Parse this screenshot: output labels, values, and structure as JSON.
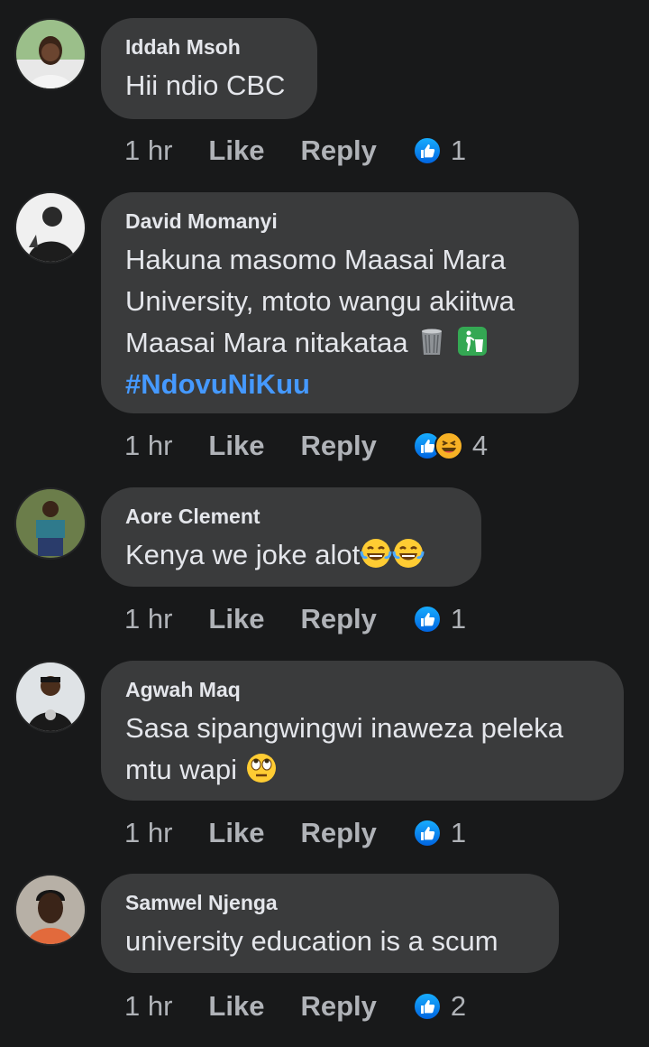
{
  "comments": [
    {
      "author": "Iddah Msoh",
      "lines": [
        "Hii ndio CBC"
      ],
      "time": "1 hr",
      "like": "Like",
      "reply": "Reply",
      "reactions": "1"
    },
    {
      "author": "David Momanyi",
      "lines": [
        "Hakuna masomo Maasai Mara",
        "University, mtoto wangu akiitwa",
        "Maasai Mara nitakataa"
      ],
      "hashtag": "#NdovuNiKuu",
      "time": "1 hr",
      "like": "Like",
      "reply": "Reply",
      "reactions": "4"
    },
    {
      "author": "Aore Clement",
      "lines": [
        "Kenya we joke alot"
      ],
      "time": "1 hr",
      "like": "Like",
      "reply": "Reply",
      "reactions": "1"
    },
    {
      "author": "Agwah Maq",
      "lines": [
        "Sasa sipangwingwi inaweza peleka",
        "mtu wapi"
      ],
      "time": "1 hr",
      "like": "Like",
      "reply": "Reply",
      "reactions": "1"
    },
    {
      "author": "Samwel Njenga",
      "lines": [
        "university education is a scum"
      ],
      "time": "1 hr",
      "like": "Like",
      "reply": "Reply",
      "reactions": "2"
    }
  ],
  "icons": {
    "like_reaction": "thumbs-up-icon",
    "haha_reaction": "laughing-face-icon",
    "trash_emoji": "wastebasket-icon",
    "litter_emoji": "put-litter-in-bin-icon",
    "tears_emoji": "tears-of-joy-icon",
    "eyeroll_emoji": "eye-roll-face-icon"
  },
  "colors": {
    "background": "#18191a",
    "bubble": "#3a3b3c",
    "hashtag": "#4599ff",
    "like_blue": "#1877f2",
    "muted": "#b0b3b8"
  }
}
